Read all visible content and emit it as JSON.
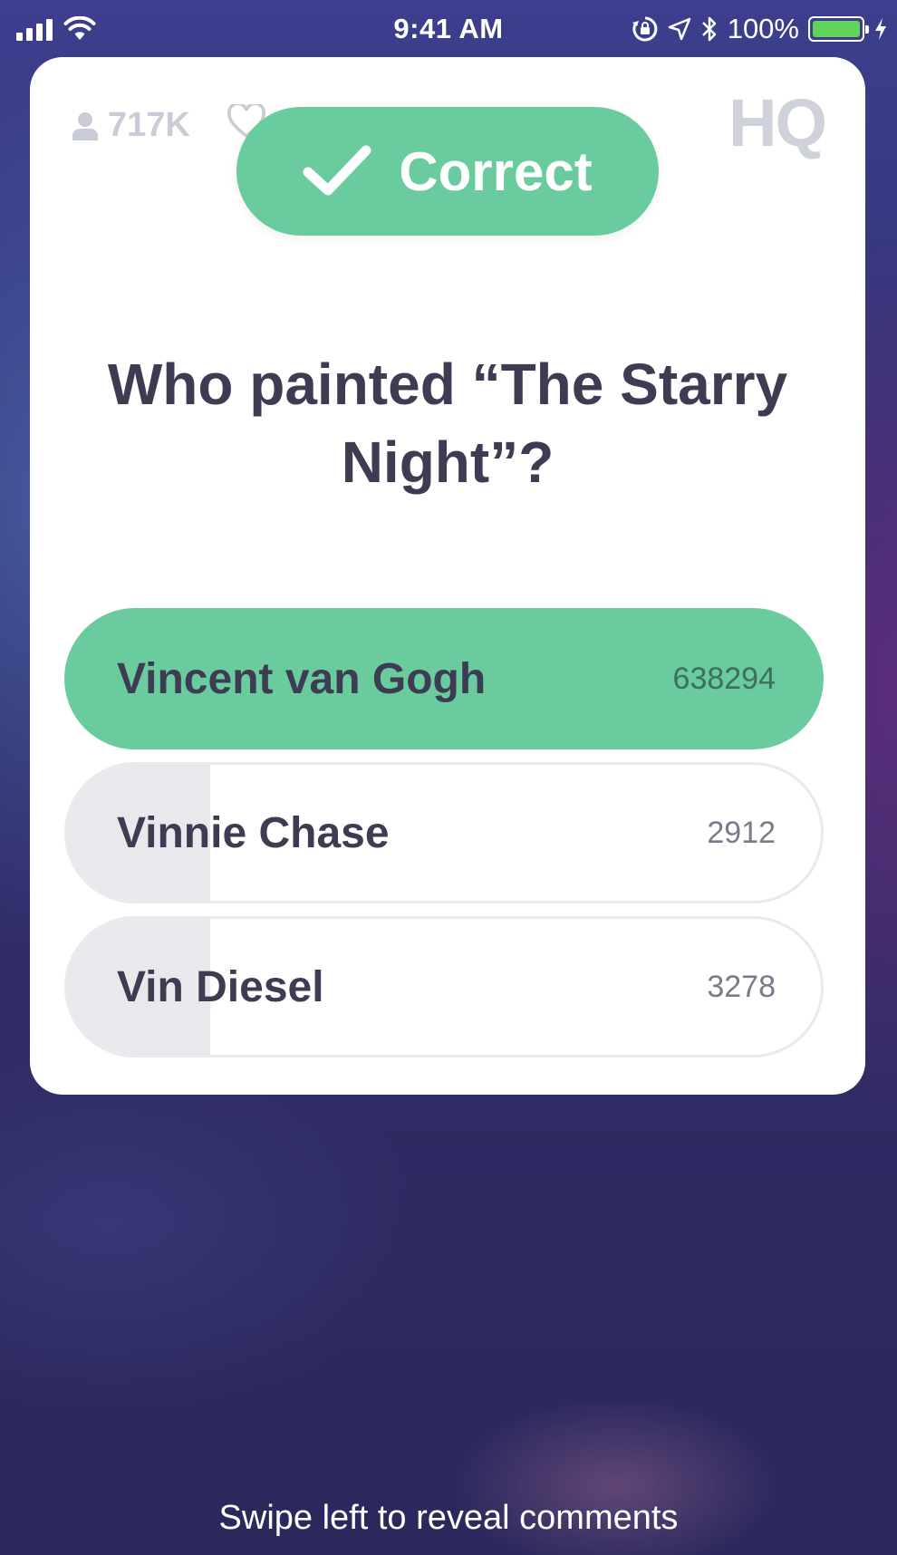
{
  "status_bar": {
    "time": "9:41 AM",
    "battery_percent": "100%",
    "battery_level": 1.0
  },
  "header": {
    "viewer_count": "717K",
    "logo_text": "HQ"
  },
  "result_banner": {
    "label": "Correct"
  },
  "question": {
    "text": "Who painted “The Starry Night”?"
  },
  "answers": [
    {
      "label": "Vincent van Gogh",
      "count": "638294",
      "correct": true
    },
    {
      "label": "Vinnie Chase",
      "count": "2912",
      "correct": false
    },
    {
      "label": "Vin Diesel",
      "count": "3278",
      "correct": false
    }
  ],
  "footer": {
    "hint": "Swipe left to reveal comments"
  },
  "colors": {
    "correct_green": "#6acb9f",
    "card_white": "#ffffff",
    "text_dark": "#3d3c52",
    "background_purple": "#2f2b64"
  },
  "icons": [
    "signal-icon",
    "wifi-icon",
    "lock-rotation-icon",
    "location-icon",
    "bluetooth-icon",
    "battery-icon",
    "charging-icon",
    "person-icon",
    "heart-icon",
    "checkmark-icon"
  ]
}
